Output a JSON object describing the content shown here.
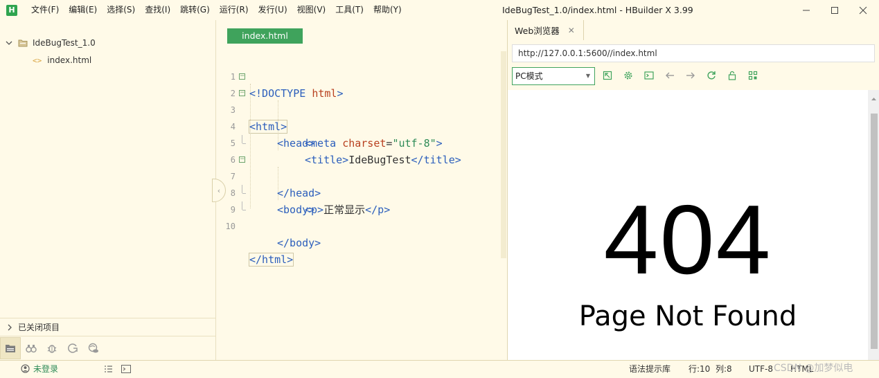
{
  "titlebar": {
    "logo": "H",
    "menu": [
      "文件(F)",
      "编辑(E)",
      "选择(S)",
      "查找(I)",
      "跳转(G)",
      "运行(R)",
      "发行(U)",
      "视图(V)",
      "工具(T)",
      "帮助(Y)"
    ],
    "window_title": "IdeBugTest_1.0/index.html - HBuilder X 3.99"
  },
  "project": {
    "root_name": "IdeBugTest_1.0",
    "file_name": "index.html",
    "closed_projects_label": "已关闭项目"
  },
  "editor": {
    "tab_label": "index.html",
    "line_numbers": [
      "1",
      "2",
      "3",
      "4",
      "5",
      "6",
      "7",
      "8",
      "9",
      "10"
    ],
    "lines": {
      "l1": {
        "p1": "<!DOCTYPE ",
        "p2": "html",
        "p3": ">"
      },
      "l2": {
        "p1": "<html>"
      },
      "l3": {
        "p1": "<head>"
      },
      "l4": {
        "p1": "<meta ",
        "p2": "charset",
        "p3": "=",
        "p4": "\"utf-8\"",
        "p5": ">"
      },
      "l5": {
        "p1": "<title>",
        "p2": "IdeBugTest",
        "p3": "</title>"
      },
      "l6": {
        "p1": "</head>"
      },
      "l7": {
        "p1": "<body>"
      },
      "l8": {
        "p1": "<p>",
        "p2": "正常显示",
        "p3": "</p>"
      },
      "l9": {
        "p1": "</body>"
      },
      "l10": {
        "p1": "</html>"
      }
    }
  },
  "browser": {
    "tab_label": "Web浏览器",
    "url": "http://127.0.0.1:5600//index.html",
    "mode": "PC模式",
    "page": {
      "code": "404",
      "message": "Page Not Found"
    }
  },
  "statusbar": {
    "login": "未登录",
    "syntax_lib": "语法提示库",
    "row": "行:10",
    "col": "列:8",
    "encoding": "UTF-8",
    "language": "HTML",
    "watermark": "CSDN @加梦似电"
  },
  "colors": {
    "accent": "#3fa35c",
    "background": "#fffae8",
    "tag": "#2b5ebc",
    "attr": "#b8401f",
    "string": "#2e8b57"
  }
}
